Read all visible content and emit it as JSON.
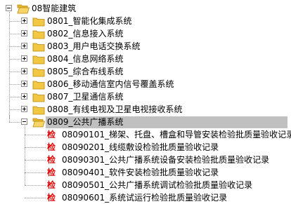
{
  "root": {
    "label": "08智能建筑"
  },
  "children": [
    {
      "label": "0801_智能化集成系统"
    },
    {
      "label": "0802_信息接入系统"
    },
    {
      "label": "0803_用户电话交换系统"
    },
    {
      "label": "0804_信息网络系统"
    },
    {
      "label": "0805_综合布线系统"
    },
    {
      "label": "0806_移动通信室内信号覆盖系统"
    },
    {
      "label": "0807_卫星通信系统"
    },
    {
      "label": "0808_有线电视及卫星电视接收系统"
    }
  ],
  "selected": {
    "label": "0809_公共广播系统",
    "records": [
      {
        "badge": "检",
        "label": "08090101_梯架、托盘、槽盒和导管安装检验批质量验收记录"
      },
      {
        "badge": "检",
        "label": "08090201_线缆敷设检验批质量验收记录"
      },
      {
        "badge": "检",
        "label": "08090301_公共广播系统设备安装检验批质量验收记录"
      },
      {
        "badge": "检",
        "label": "08090401_软件安装检验批质量验收记录"
      },
      {
        "badge": "检",
        "label": "08090501_公共广播系统调试检验批质量验收记录"
      },
      {
        "badge": "检",
        "label": "08090601_系统试运行检验批质量验收记录"
      }
    ]
  },
  "colors": {
    "badge": "#e00000",
    "selection": "#c0c0c0",
    "folder": "#f2c744"
  }
}
